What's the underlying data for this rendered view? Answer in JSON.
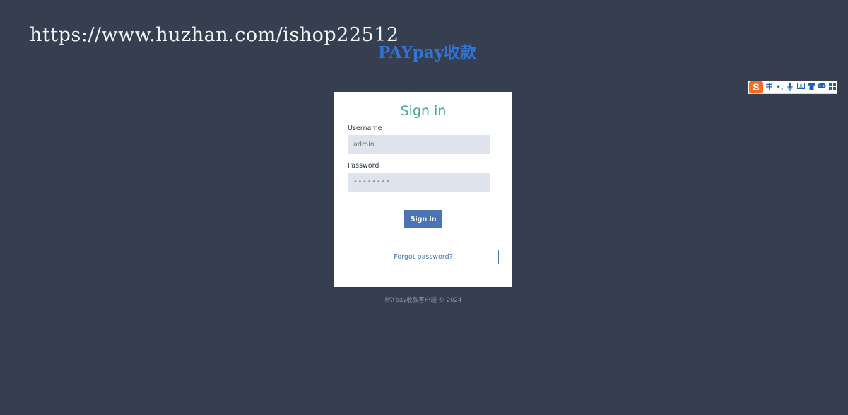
{
  "watermark": {
    "url": "https://www.huzhan.com/ishop22512"
  },
  "brand": {
    "title": "PAYpay收款",
    "color": "#2f74d9"
  },
  "ime_toolbar": {
    "logo": "S",
    "buttons": [
      {
        "glyph": "中",
        "icon": "chinese-mode-icon"
      },
      {
        "glyph": "•,",
        "icon": "punctuation-icon"
      },
      {
        "glyph": "🎤",
        "icon": "microphone-icon"
      },
      {
        "glyph": "⌨",
        "icon": "keyboard-icon"
      },
      {
        "glyph": "👕",
        "icon": "skin-icon"
      },
      {
        "glyph": "🎮",
        "icon": "game-icon"
      },
      {
        "glyph": "▦",
        "icon": "toolbox-icon"
      }
    ]
  },
  "login": {
    "title": "Sign in",
    "username_label": "Username",
    "username_placeholder": "admin",
    "password_label": "Password",
    "password_value": "••••••••",
    "signin_label": "Sign in",
    "forgot_label": "Forgot password?",
    "title_color": "#45a898",
    "accent_color": "#4a74b3"
  },
  "footer": {
    "text": "PAYpay收款客户端 © 2024"
  },
  "colors": {
    "background": "#353f4f",
    "card": "#ffffff",
    "input_fill": "#dee3ed"
  }
}
